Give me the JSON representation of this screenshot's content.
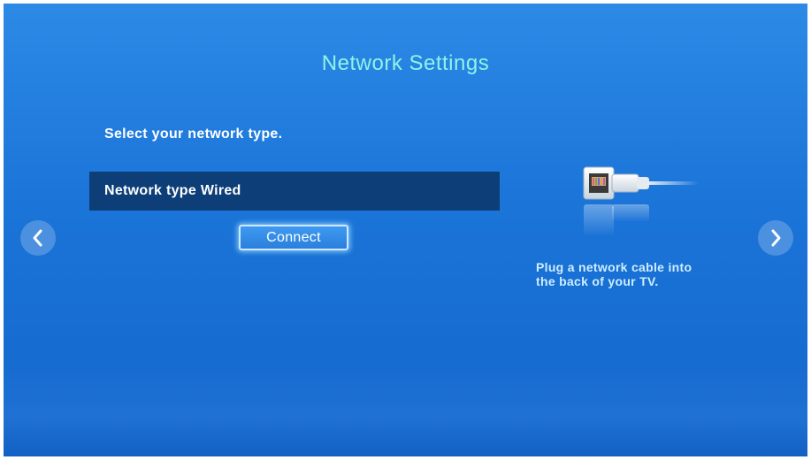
{
  "screen": {
    "title": "Network Settings",
    "prompt": "Select your network type.",
    "network_type_label": "Network type Wired",
    "connect_label": "Connect",
    "hint_line1": "Plug a network cable into",
    "hint_line2": "the back of your TV."
  },
  "icons": {
    "left": "chevron-left-icon",
    "right": "chevron-right-icon",
    "illustration": "network-cable-icon"
  },
  "colors": {
    "background": "#1b74d8",
    "title": "#8ff3e8",
    "selected_row": "#0d3e78",
    "hint_text": "#cdeeff"
  }
}
